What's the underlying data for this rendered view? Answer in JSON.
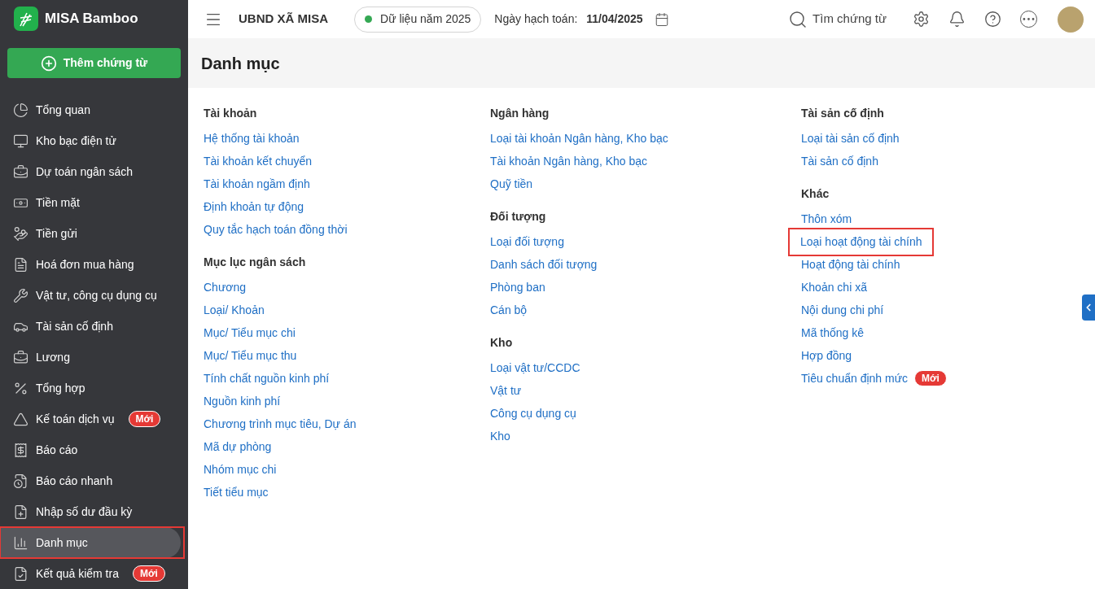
{
  "app": {
    "name": "MISA Bamboo",
    "add_button": "Thêm chứng từ"
  },
  "sidebar": {
    "items": [
      {
        "label": "Tổng quan",
        "selected": false,
        "highlighted": false
      },
      {
        "label": "Kho bạc điện tử",
        "selected": false,
        "highlighted": false
      },
      {
        "label": "Dự toán ngân sách",
        "selected": false,
        "highlighted": false
      },
      {
        "label": "Tiền mặt",
        "selected": false,
        "highlighted": false
      },
      {
        "label": "Tiền gửi",
        "selected": false,
        "highlighted": false
      },
      {
        "label": "Hoá đơn mua hàng",
        "selected": false,
        "highlighted": false
      },
      {
        "label": "Vật tư, công cụ dụng cụ",
        "selected": false,
        "highlighted": false
      },
      {
        "label": "Tài sản cố định",
        "selected": false,
        "highlighted": false
      },
      {
        "label": "Lương",
        "selected": false,
        "highlighted": false
      },
      {
        "label": "Tổng hợp",
        "selected": false,
        "highlighted": false
      },
      {
        "label": "Kế toán dịch vụ",
        "badge": "Mới",
        "selected": false,
        "highlighted": false
      },
      {
        "label": "Báo cáo",
        "selected": false,
        "highlighted": false
      },
      {
        "label": "Báo cáo nhanh",
        "selected": false,
        "highlighted": false
      },
      {
        "label": "Nhập số dư đầu kỳ",
        "selected": false,
        "highlighted": false
      },
      {
        "label": "Danh mục",
        "selected": true,
        "highlighted": true
      },
      {
        "label": "Kết quả kiểm tra",
        "badge": "Mới",
        "selected": false,
        "highlighted": false
      }
    ]
  },
  "header": {
    "organization": "UBND XÃ MISA",
    "data_year": "Dữ liệu năm 2025",
    "posting_date_label": "Ngày hạch toán:",
    "posting_date": "11/04/2025",
    "search_label": "Tìm chứng từ"
  },
  "page": {
    "title": "Danh mục",
    "columns": [
      {
        "sections": [
          {
            "title": "Tài khoản",
            "links": [
              {
                "label": "Hệ thống tài khoản",
                "highlighted": false
              },
              {
                "label": "Tài khoản kết chuyển",
                "highlighted": false
              },
              {
                "label": "Tài khoản ngầm định",
                "highlighted": false
              },
              {
                "label": "Định khoản tự động",
                "highlighted": false
              },
              {
                "label": "Quy tắc hạch toán đồng thời",
                "highlighted": false
              }
            ]
          },
          {
            "title": "Mục lục ngân sách",
            "links": [
              {
                "label": "Chương",
                "highlighted": false
              },
              {
                "label": "Loại/ Khoản",
                "highlighted": false
              },
              {
                "label": "Mục/ Tiểu mục chi",
                "highlighted": false
              },
              {
                "label": "Mục/ Tiểu mục thu",
                "highlighted": false
              },
              {
                "label": "Tính chất nguồn kinh phí",
                "highlighted": false
              },
              {
                "label": "Nguồn kinh phí",
                "highlighted": false
              },
              {
                "label": "Chương trình mục tiêu, Dự án",
                "highlighted": false
              },
              {
                "label": "Mã dự phòng",
                "highlighted": false
              },
              {
                "label": "Nhóm mục chi",
                "highlighted": false
              },
              {
                "label": "Tiết tiểu mục",
                "highlighted": false
              }
            ]
          }
        ]
      },
      {
        "sections": [
          {
            "title": "Ngân hàng",
            "links": [
              {
                "label": "Loại tài khoản Ngân hàng, Kho bạc",
                "highlighted": false
              },
              {
                "label": "Tài khoản Ngân hàng, Kho bạc",
                "highlighted": false
              },
              {
                "label": "Quỹ tiền",
                "highlighted": false
              }
            ]
          },
          {
            "title": "Đối tượng",
            "links": [
              {
                "label": "Loại đối tượng",
                "highlighted": false
              },
              {
                "label": "Danh sách đối tượng",
                "highlighted": false
              },
              {
                "label": "Phòng ban",
                "highlighted": false
              },
              {
                "label": "Cán bộ",
                "highlighted": false
              }
            ]
          },
          {
            "title": "Kho",
            "links": [
              {
                "label": "Loại vật tư/CCDC",
                "highlighted": false
              },
              {
                "label": "Vật tư",
                "highlighted": false
              },
              {
                "label": "Công cụ dụng cụ",
                "highlighted": false
              },
              {
                "label": "Kho",
                "highlighted": false
              }
            ]
          }
        ]
      },
      {
        "sections": [
          {
            "title": "Tài sản cố định",
            "links": [
              {
                "label": "Loại tài sản cố định",
                "highlighted": false
              },
              {
                "label": "Tài sản cố định",
                "highlighted": false
              }
            ]
          },
          {
            "title": "Khác",
            "links": [
              {
                "label": "Thôn xóm",
                "highlighted": false
              },
              {
                "label": "Loại hoạt động tài chính",
                "highlighted": true
              },
              {
                "label": "Hoạt động tài chính",
                "highlighted": false
              },
              {
                "label": "Khoản chi xã",
                "highlighted": false
              },
              {
                "label": "Nội dung chi phí",
                "highlighted": false
              },
              {
                "label": "Mã thống kê",
                "highlighted": false
              },
              {
                "label": "Hợp đồng",
                "highlighted": false
              },
              {
                "label": "Tiêu chuẩn định mức",
                "badge": "Mới",
                "highlighted": false
              }
            ]
          }
        ]
      }
    ]
  }
}
